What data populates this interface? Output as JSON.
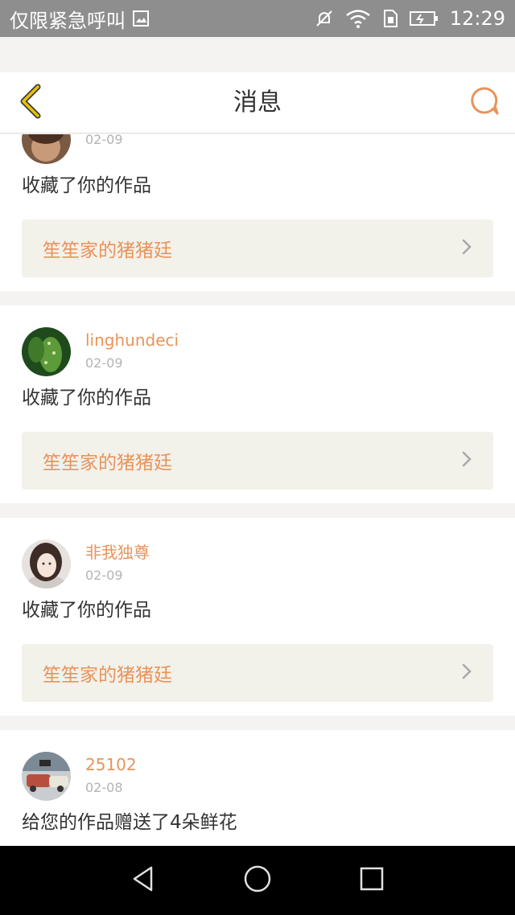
{
  "status_bar": {
    "carrier_text": "仅限紧急呼叫",
    "time": "12:29",
    "icons": [
      "image-icon",
      "mute-icon",
      "wifi-icon",
      "sim-icon",
      "battery-charging-icon"
    ]
  },
  "header": {
    "title": "消息",
    "back_icon": "chevron-left-icon",
    "chat_icon": "chat-bubble-icon"
  },
  "messages": [
    {
      "username": "",
      "date": "02-09",
      "action": "收藏了你的作品",
      "work_title": "笙笙家的猪猪廷",
      "avatar": "brown-avatar"
    },
    {
      "username": "linghundeci",
      "date": "02-09",
      "action": "收藏了你的作品",
      "work_title": "笙笙家的猪猪廷",
      "avatar": "green-plant-avatar"
    },
    {
      "username": "非我独尊",
      "date": "02-09",
      "action": "收藏了你的作品",
      "work_title": "笙笙家的猪猪廷",
      "avatar": "girl-avatar"
    },
    {
      "username": "25102",
      "date": "02-08",
      "action": "给您的作品赠送了4朵鲜花",
      "work_title": "",
      "avatar": "street-avatar"
    }
  ],
  "colors": {
    "accent": "#e9935a",
    "back_icon": "#e8c400",
    "link_bg": "#f2f1ea"
  },
  "nav_bar": {
    "icons": [
      "back-triangle-icon",
      "home-circle-icon",
      "recents-square-icon"
    ]
  }
}
